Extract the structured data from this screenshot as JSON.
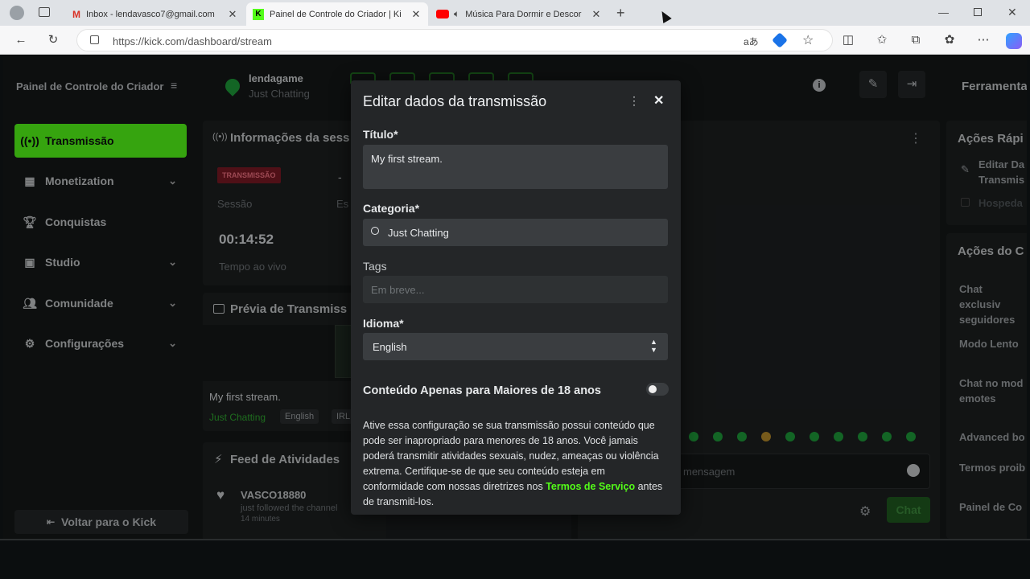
{
  "browser": {
    "tabs": [
      {
        "title": "Inbox - lendavasco7@gmail.com",
        "icon": "gmail-icon"
      },
      {
        "title": "Painel de Controle do Criador | Ki",
        "icon": "kick-icon"
      },
      {
        "title": "Música Para Dormir e Descor",
        "icon": "youtube-icon"
      }
    ],
    "url": "https://kick.com/dashboard/stream"
  },
  "sidebar": {
    "title": "Painel de Controle do Criador",
    "items": [
      {
        "label": "Transmissão",
        "icon": "broadcast-icon"
      },
      {
        "label": "Monetization",
        "icon": "chart-icon"
      },
      {
        "label": "Conquistas",
        "icon": "trophy-icon"
      },
      {
        "label": "Studio",
        "icon": "studio-icon"
      },
      {
        "label": "Comunidade",
        "icon": "community-icon"
      },
      {
        "label": "Configurações",
        "icon": "gear-icon"
      }
    ],
    "back_label": "Voltar para o Kick"
  },
  "header": {
    "channel": "lendagame",
    "category": "Just Chatting",
    "right_title": "Ferramenta"
  },
  "session": {
    "title": "Informações da sess",
    "badge": "TRANSMISSÃO",
    "session_label": "Sessão",
    "es_label": "Es",
    "dash": "-",
    "time": "00:14:52",
    "time_label": "Tempo ao vivo"
  },
  "preview": {
    "title": "Prévia de Transmiss",
    "stream_title": "My first stream.",
    "category": "Just Chatting",
    "tags": [
      "English",
      "IRL"
    ]
  },
  "feed": {
    "title": "Feed de Atividades",
    "user": "VASCO18880",
    "action": "just followed the channel",
    "time": "14 minutes"
  },
  "chat": {
    "placeholder": "mensagem",
    "send_label": "Chat"
  },
  "quick_actions": {
    "title": "Ações Rápi",
    "edit": "Editar Da Transmis",
    "host": "Hospeda"
  },
  "chat_actions": {
    "title": "Ações do C",
    "items": [
      "Chat exclusiv seguidores",
      "Modo Lento",
      "Chat no mod emotes",
      "Advanced bo",
      "Termos proib",
      "Painel de Co"
    ]
  },
  "modal": {
    "title": "Editar dados da transmissão",
    "title_label": "Título*",
    "title_value": "My first stream.",
    "category_label": "Categoria*",
    "category_value": "Just Chatting",
    "tags_label": "Tags",
    "tags_placeholder": "Em breve...",
    "language_label": "Idioma*",
    "language_value": "English",
    "adult_label": "Conteúdo Apenas para Maiores de 18 anos",
    "adult_enabled": false,
    "desc_before": "Ative essa configuração se sua transmissão possui conteúdo que pode ser inapropriado para menores de 18 anos. Você jamais poderá transmitir atividades sexuais, nudez, ameaças ou violência extrema. Certifique-se de que seu conteúdo esteja em conformidade com nossas diretrizes nos ",
    "desc_link": "Termos de Serviço",
    "desc_after": " antes de transmiti-los."
  },
  "colors": {
    "accent": "#53fc18",
    "background": "#141718",
    "modal": "#242628"
  }
}
